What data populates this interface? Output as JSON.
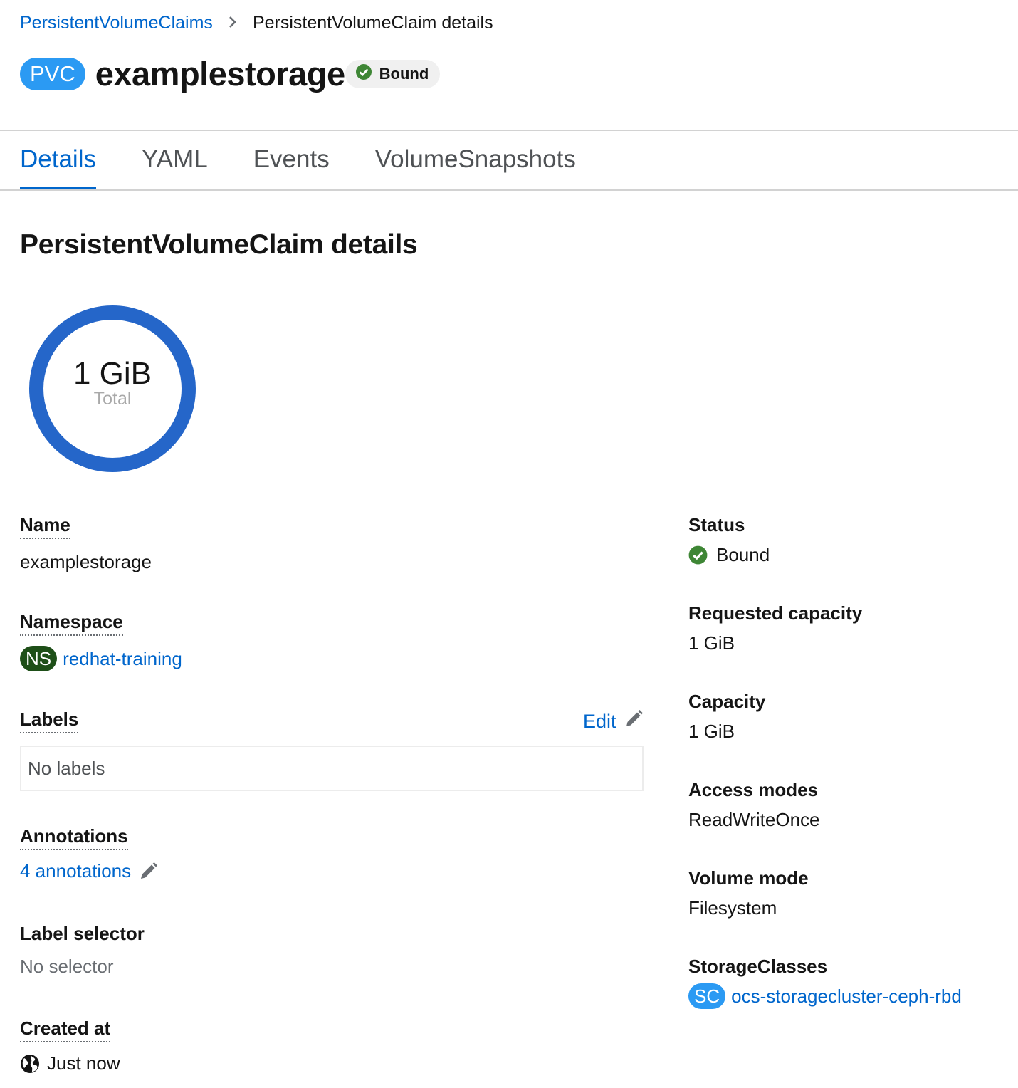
{
  "breadcrumb": {
    "parent": "PersistentVolumeClaims",
    "separator_icon": "chevron-right-icon",
    "current": "PersistentVolumeClaim details"
  },
  "header": {
    "kind_badge": "PVC",
    "name": "examplestorage",
    "status": "Bound",
    "status_icon": "check-circle-icon",
    "status_color": "#3e8635"
  },
  "tabs": [
    {
      "label": "Details",
      "active": true
    },
    {
      "label": "YAML",
      "active": false
    },
    {
      "label": "Events",
      "active": false
    },
    {
      "label": "VolumeSnapshots",
      "active": false
    }
  ],
  "section_title": "PersistentVolumeClaim details",
  "usage_donut": {
    "value": "1 GiB",
    "label": "Total",
    "ring_color": "#2566c9"
  },
  "left_fields": {
    "name": {
      "label": "Name",
      "value": "examplestorage"
    },
    "namespace": {
      "label": "Namespace",
      "badge": "NS",
      "value": "redhat-training"
    },
    "labels": {
      "label": "Labels",
      "edit_label": "Edit",
      "edit_icon": "pencil-icon",
      "empty_text": "No labels"
    },
    "annotations": {
      "label": "Annotations",
      "value": "4 annotations",
      "edit_icon": "pencil-icon"
    },
    "label_selector": {
      "label": "Label selector",
      "value": "No selector"
    },
    "created_at": {
      "label": "Created at",
      "icon": "globe-icon",
      "value": "Just now"
    }
  },
  "right_fields": {
    "status": {
      "label": "Status",
      "icon": "check-circle-icon",
      "value": "Bound"
    },
    "requested_capacity": {
      "label": "Requested capacity",
      "value": "1 GiB"
    },
    "capacity": {
      "label": "Capacity",
      "value": "1 GiB"
    },
    "access_modes": {
      "label": "Access modes",
      "value": "ReadWriteOnce"
    },
    "volume_mode": {
      "label": "Volume mode",
      "value": "Filesystem"
    },
    "storage_classes": {
      "label": "StorageClasses",
      "badge": "SC",
      "value": "ocs-storagecluster-ceph-rbd"
    }
  },
  "colors": {
    "link": "#0066cc",
    "ns_badge": "#1e4f18",
    "sc_badge": "#2b9af3",
    "pvc_badge": "#2b9af3",
    "success": "#3e8635"
  }
}
